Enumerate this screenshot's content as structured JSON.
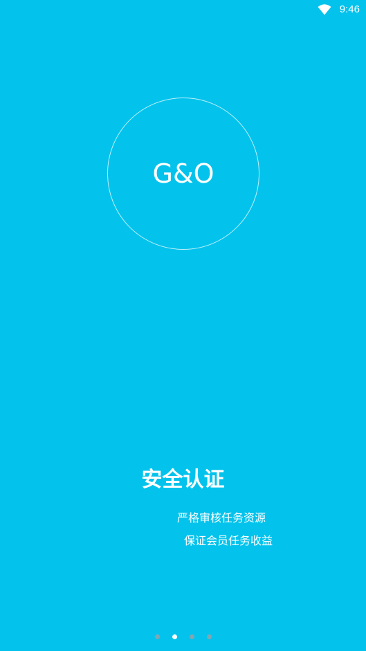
{
  "status_bar": {
    "time": "9:46",
    "wifi_icon": "wifi-icon"
  },
  "logo": {
    "text": "G&O"
  },
  "onboarding": {
    "title": "安全认证",
    "subtitle_lines": [
      "严格审核任务资源",
      "保证会员任务收益"
    ]
  },
  "page_indicator": {
    "page_count": 4,
    "active_index": 1
  },
  "colors": {
    "background": "#03c3ec",
    "dot_active": "#ffffff",
    "dot_inactive": "#7fa6b3"
  }
}
